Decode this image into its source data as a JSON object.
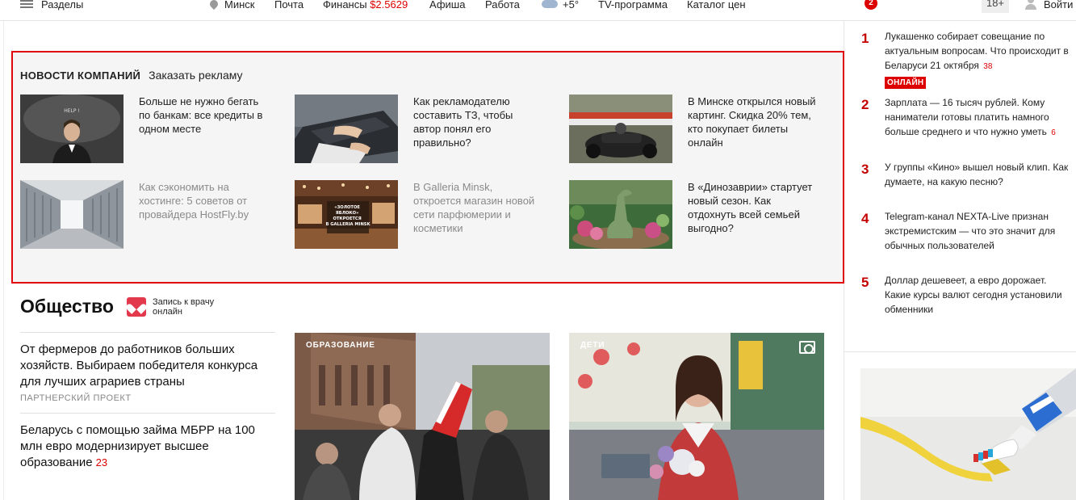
{
  "topbar": {
    "sections_label": "Разделы",
    "city": "Минск",
    "mail": "Почта",
    "finance": "Финансы",
    "finance_value": "$2.5629",
    "afisha": "Афиша",
    "work": "Работа",
    "temperature": "+5°",
    "tv": "TV-программа",
    "catalog": "Каталог цен",
    "notifications": "2",
    "age": "18+",
    "login": "Войти"
  },
  "company": {
    "title": "Новости компаний",
    "order_ad": "Заказать рекламу",
    "cards": [
      {
        "text": "Больше не нужно бегать по банкам: все кредиты в одном месте",
        "grey": false,
        "img_label": "HELP !"
      },
      {
        "text": "Как рекламодателю составить ТЗ, чтобы автор понял его правильно?",
        "grey": false
      },
      {
        "text": "В Минске открылся новый картинг. Скидка 20% тем, кто покупает билеты онлайн",
        "grey": false
      },
      {
        "text": "Как сэкономить на хостинге: 5 советов от провайдера HostFly.by",
        "grey": true
      },
      {
        "text": "В Galleria Minsk, откроется магазин новой сети парфюмерии и косметики",
        "grey": true,
        "img_label": "«ЗОЛОТОЕ ЯБЛОКО» ОТКРОЕТСЯ В GALLERIA MINSK"
      },
      {
        "text": "В «Динозаврии» стартует новый сезон. Как отдохнуть всей семьей выгодно?",
        "grey": false
      }
    ]
  },
  "society": {
    "title": "Общество",
    "appointment": "Запись к врачу онлайн",
    "news": [
      {
        "headline": "От фермеров до работников больших хозяйств. Выбираем победителя конкурса для лучших аграриев страны",
        "partner": "ПАРТНЕРСКИЙ ПРОЕКТ",
        "count": ""
      },
      {
        "headline": "Беларусь с помощью займа МБРР на 100 млн евро модернизирует высшее образование",
        "partner": "",
        "count": "23"
      }
    ],
    "photos": [
      {
        "tag": "ОБРАЗОВАНИЕ"
      },
      {
        "tag": "ДЕТИ"
      }
    ]
  },
  "top_news": [
    {
      "num": "1",
      "text": "Лукашенко собирает совещание по актуальным вопросам. Что происходит в Беларуси 21 октября",
      "count": "38",
      "online": "ОНЛАЙН"
    },
    {
      "num": "2",
      "text": "Зарплата — 16 тысяч рублей. Кому наниматели готовы платить намного больше среднего и что нужно уметь",
      "count": "6",
      "online": ""
    },
    {
      "num": "3",
      "text": "У группы «Кино» вышел новый клип. Как думаете, на какую песню?",
      "count": "",
      "online": ""
    },
    {
      "num": "4",
      "text": "Telegram-канал NEXTA-Live признан экстремистским — что это значит для обычных пользователей",
      "count": "",
      "online": ""
    },
    {
      "num": "5",
      "text": "Доллар дешевеет, а евро дорожает. Какие курсы валют сегодня установили обменники",
      "count": "",
      "online": ""
    }
  ],
  "colors": {
    "accent": "#e0060f",
    "number": "#c40000",
    "link_grey": "#8a8a8a"
  }
}
